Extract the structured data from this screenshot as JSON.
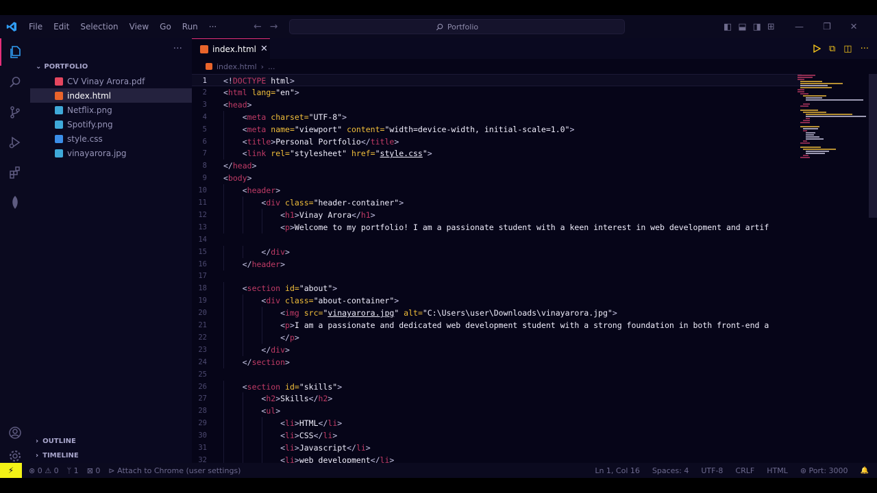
{
  "colors": {
    "accent_pink": "#e52f7a",
    "vscode_blue": "#2f9df4",
    "remote_yellow": "#f3f216",
    "run_yellow": "#f3c31b"
  },
  "menu": [
    "File",
    "Edit",
    "Selection",
    "View",
    "Go",
    "Run",
    "···"
  ],
  "command_center": {
    "label": "Portfolio",
    "icon": "search-icon"
  },
  "sidebar": {
    "more": "···",
    "folder": "PORTFOLIO",
    "files": [
      {
        "name": "CV Vinay Arora.pdf",
        "type": "pdf"
      },
      {
        "name": "index.html",
        "type": "html"
      },
      {
        "name": "Netflix.png",
        "type": "png"
      },
      {
        "name": "Spotify.png",
        "type": "png"
      },
      {
        "name": "style.css",
        "type": "css"
      },
      {
        "name": "vinayarora.jpg",
        "type": "png"
      }
    ],
    "outline": "OUTLINE",
    "timeline": "TIMELINE"
  },
  "editor": {
    "tab": {
      "label": "index.html",
      "close": "✕"
    },
    "breadcrumb": {
      "file": "index.html",
      "more": "..."
    },
    "code_lines": [
      [
        [
          "br",
          "<!"
        ],
        [
          "tg",
          "DOCTYPE"
        ],
        [
          "st",
          " html"
        ],
        [
          "br",
          ">"
        ]
      ],
      [
        [
          "br",
          "<"
        ],
        [
          "tg",
          "html"
        ],
        [
          "at",
          " lang="
        ],
        [
          "st",
          "\"en\""
        ],
        [
          "br",
          ">"
        ]
      ],
      [
        [
          "br",
          "<"
        ],
        [
          "tg",
          "head"
        ],
        [
          "br",
          ">"
        ]
      ],
      [
        [
          "st",
          "    "
        ],
        [
          "br",
          "<"
        ],
        [
          "tg",
          "meta"
        ],
        [
          "at",
          " charset="
        ],
        [
          "st",
          "\"UTF-8\""
        ],
        [
          "br",
          ">"
        ]
      ],
      [
        [
          "st",
          "    "
        ],
        [
          "br",
          "<"
        ],
        [
          "tg",
          "meta"
        ],
        [
          "at",
          " name="
        ],
        [
          "st",
          "\"viewport\""
        ],
        [
          "at",
          " content="
        ],
        [
          "st",
          "\"width=device-width, initial-scale=1.0\""
        ],
        [
          "br",
          ">"
        ]
      ],
      [
        [
          "st",
          "    "
        ],
        [
          "br",
          "<"
        ],
        [
          "tg",
          "title"
        ],
        [
          "br",
          ">"
        ],
        [
          "st",
          "Personal Portfolio"
        ],
        [
          "br",
          "</"
        ],
        [
          "tg",
          "title"
        ],
        [
          "br",
          ">"
        ]
      ],
      [
        [
          "st",
          "    "
        ],
        [
          "br",
          "<"
        ],
        [
          "tg",
          "link"
        ],
        [
          "at",
          " rel="
        ],
        [
          "st",
          "\"stylesheet\""
        ],
        [
          "at",
          " href="
        ],
        [
          "st",
          "\""
        ],
        [
          "lk",
          "style.css"
        ],
        [
          "st",
          "\""
        ],
        [
          "br",
          ">"
        ]
      ],
      [
        [
          "br",
          "</"
        ],
        [
          "tg",
          "head"
        ],
        [
          "br",
          ">"
        ]
      ],
      [
        [
          "br",
          "<"
        ],
        [
          "tg",
          "body"
        ],
        [
          "br",
          ">"
        ]
      ],
      [
        [
          "st",
          "    "
        ],
        [
          "br",
          "<"
        ],
        [
          "tg",
          "header"
        ],
        [
          "br",
          ">"
        ]
      ],
      [
        [
          "st",
          "        "
        ],
        [
          "br",
          "<"
        ],
        [
          "tg",
          "div"
        ],
        [
          "at",
          " class="
        ],
        [
          "st",
          "\"header-container\""
        ],
        [
          "br",
          ">"
        ]
      ],
      [
        [
          "st",
          "            "
        ],
        [
          "br",
          "<"
        ],
        [
          "tg",
          "h1"
        ],
        [
          "br",
          ">"
        ],
        [
          "st",
          "Vinay Arora"
        ],
        [
          "br",
          "</"
        ],
        [
          "tg",
          "h1"
        ],
        [
          "br",
          ">"
        ]
      ],
      [
        [
          "st",
          "            "
        ],
        [
          "br",
          "<"
        ],
        [
          "tg",
          "p"
        ],
        [
          "br",
          ">"
        ],
        [
          "st",
          "Welcome to my portfolio! I am a passionate student with a keen interest in web development and artif"
        ]
      ],
      [],
      [
        [
          "st",
          "        "
        ],
        [
          "br",
          "</"
        ],
        [
          "tg",
          "div"
        ],
        [
          "br",
          ">"
        ]
      ],
      [
        [
          "st",
          "    "
        ],
        [
          "br",
          "</"
        ],
        [
          "tg",
          "header"
        ],
        [
          "br",
          ">"
        ]
      ],
      [],
      [
        [
          "st",
          "    "
        ],
        [
          "br",
          "<"
        ],
        [
          "tg",
          "section"
        ],
        [
          "at",
          " id="
        ],
        [
          "st",
          "\"about\""
        ],
        [
          "br",
          ">"
        ]
      ],
      [
        [
          "st",
          "        "
        ],
        [
          "br",
          "<"
        ],
        [
          "tg",
          "div"
        ],
        [
          "at",
          " class="
        ],
        [
          "st",
          "\"about-container\""
        ],
        [
          "br",
          ">"
        ]
      ],
      [
        [
          "st",
          "            "
        ],
        [
          "br",
          "<"
        ],
        [
          "tg",
          "img"
        ],
        [
          "at",
          " src="
        ],
        [
          "st",
          "\""
        ],
        [
          "lk",
          "vinayarora.jpg"
        ],
        [
          "st",
          "\""
        ],
        [
          "at",
          " alt="
        ],
        [
          "st",
          "\"C:\\Users\\user\\Downloads\\vinayarora.jpg\""
        ],
        [
          "br",
          ">"
        ]
      ],
      [
        [
          "st",
          "            "
        ],
        [
          "br",
          "<"
        ],
        [
          "tg",
          "p"
        ],
        [
          "br",
          ">"
        ],
        [
          "st",
          "I am a passionate and dedicated web development student with a strong foundation in both front-end a"
        ]
      ],
      [
        [
          "st",
          "            "
        ],
        [
          "br",
          "</"
        ],
        [
          "tg",
          "p"
        ],
        [
          "br",
          ">"
        ]
      ],
      [
        [
          "st",
          "        "
        ],
        [
          "br",
          "</"
        ],
        [
          "tg",
          "div"
        ],
        [
          "br",
          ">"
        ]
      ],
      [
        [
          "st",
          "    "
        ],
        [
          "br",
          "</"
        ],
        [
          "tg",
          "section"
        ],
        [
          "br",
          ">"
        ]
      ],
      [],
      [
        [
          "st",
          "    "
        ],
        [
          "br",
          "<"
        ],
        [
          "tg",
          "section"
        ],
        [
          "at",
          " id="
        ],
        [
          "st",
          "\"skills\""
        ],
        [
          "br",
          ">"
        ]
      ],
      [
        [
          "st",
          "        "
        ],
        [
          "br",
          "<"
        ],
        [
          "tg",
          "h2"
        ],
        [
          "br",
          ">"
        ],
        [
          "st",
          "Skills"
        ],
        [
          "br",
          "</"
        ],
        [
          "tg",
          "h2"
        ],
        [
          "br",
          ">"
        ]
      ],
      [
        [
          "st",
          "        "
        ],
        [
          "br",
          "<"
        ],
        [
          "tg",
          "ul"
        ],
        [
          "br",
          ">"
        ]
      ],
      [
        [
          "st",
          "            "
        ],
        [
          "br",
          "<"
        ],
        [
          "tg",
          "li"
        ],
        [
          "br",
          ">"
        ],
        [
          "st",
          "HTML"
        ],
        [
          "br",
          "</"
        ],
        [
          "tg",
          "li"
        ],
        [
          "br",
          ">"
        ]
      ],
      [
        [
          "st",
          "            "
        ],
        [
          "br",
          "<"
        ],
        [
          "tg",
          "li"
        ],
        [
          "br",
          ">"
        ],
        [
          "st",
          "CSS"
        ],
        [
          "br",
          "</"
        ],
        [
          "tg",
          "li"
        ],
        [
          "br",
          ">"
        ]
      ],
      [
        [
          "st",
          "            "
        ],
        [
          "br",
          "<"
        ],
        [
          "tg",
          "li"
        ],
        [
          "br",
          ">"
        ],
        [
          "st",
          "Javascript"
        ],
        [
          "br",
          "</"
        ],
        [
          "tg",
          "li"
        ],
        [
          "br",
          ">"
        ]
      ],
      [
        [
          "st",
          "            "
        ],
        [
          "br",
          "<"
        ],
        [
          "tg",
          "li"
        ],
        [
          "br",
          ">"
        ],
        [
          "st",
          "web development"
        ],
        [
          "br",
          "</"
        ],
        [
          "tg",
          "li"
        ],
        [
          "br",
          ">"
        ]
      ]
    ]
  },
  "statusbar": {
    "remote": "⚡",
    "errors": "⊗ 0 ⚠ 0",
    "info": "ᛘ 1",
    "ports": "⊠ 0",
    "debug": "⊳ Attach to Chrome (user settings)",
    "cursor": "Ln 1, Col 16",
    "spaces": "Spaces: 4",
    "encoding": "UTF-8",
    "eol": "CRLF",
    "language": "HTML",
    "port": "⊛ Port: 3000",
    "bell": "🔔"
  }
}
